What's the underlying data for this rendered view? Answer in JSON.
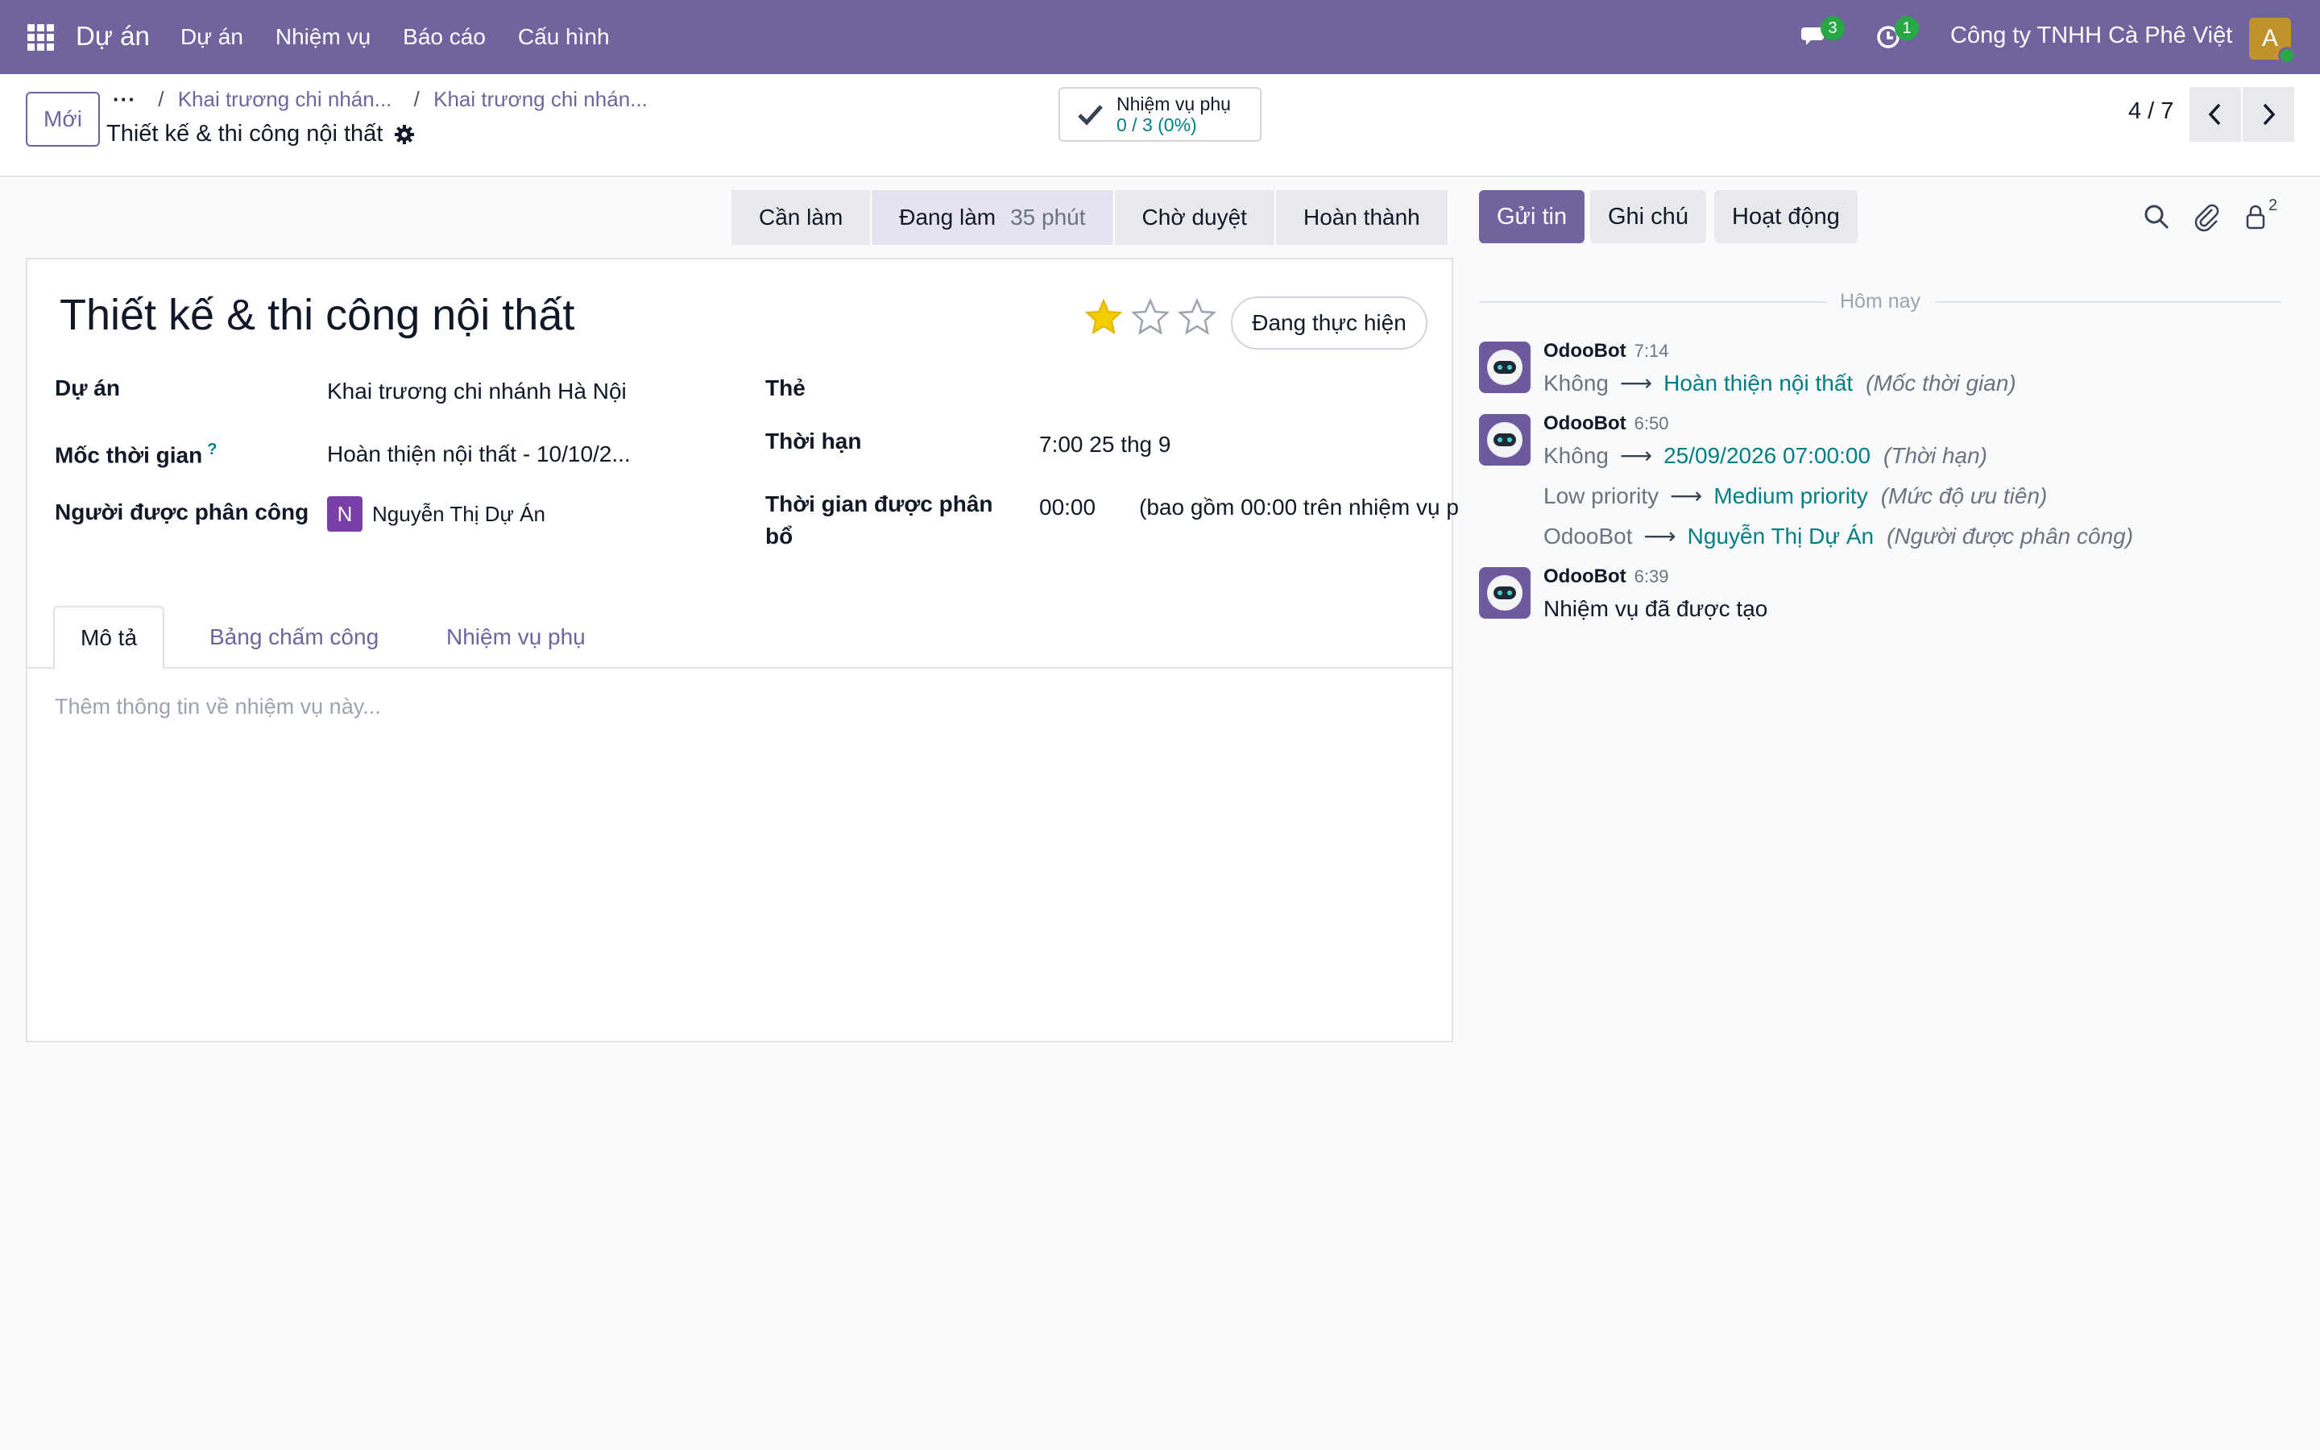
{
  "navbar": {
    "brand": "Dự án",
    "menu": [
      "Dự án",
      "Nhiệm vụ",
      "Báo cáo",
      "Cấu hình"
    ],
    "messages_count": "3",
    "activities_count": "1",
    "company": "Công ty TNHH Cà Phê Việt",
    "user_initial": "A",
    "accent_color": "#71639e"
  },
  "control": {
    "new_label": "Mới",
    "breadcrumb_more": "···",
    "breadcrumbs": [
      "Khai trương chi nhán...",
      "Khai trương chi nhán..."
    ],
    "record_title": "Thiết kế & thi công nội thất",
    "subtasks_label": "Nhiệm vụ phụ",
    "subtasks_value": "0 / 3 (0%)",
    "pager": "4 / 7"
  },
  "status": {
    "stages": [
      {
        "label": "Cần làm",
        "duration": ""
      },
      {
        "label": "Đang làm",
        "duration": "35 phút",
        "active": true
      },
      {
        "label": "Chờ duyệt",
        "duration": ""
      },
      {
        "label": "Hoàn thành",
        "duration": ""
      }
    ]
  },
  "form": {
    "task_name": "Thiết kế & thi công nội thất",
    "priority_stars": 1,
    "priority_max": 3,
    "state_label": "Đang thực hiện",
    "fields": {
      "project_label": "Dự án",
      "project_value": "Khai trương chi nhánh Hà Nội",
      "milestone_label": "Mốc thời gian",
      "milestone_help": "?",
      "milestone_value": "Hoàn thiện nội thất - 10/10/2...",
      "assignee_label": "Người được phân công",
      "assignee_initial": "N",
      "assignee_value": "Nguyễn Thị Dự Án",
      "tags_label": "Thẻ",
      "deadline_label": "Thời hạn",
      "deadline_value": "7:00 25 thg 9",
      "allocated_label_1": "Thời gian được phân",
      "allocated_label_2": "bổ",
      "allocated_value": "00:00",
      "allocated_note": "(bao gồm 00:00 trên nhiệm vụ p"
    },
    "tabs": [
      "Mô tả",
      "Bảng chấm công",
      "Nhiệm vụ phụ"
    ],
    "description_placeholder": "Thêm thông tin về nhiệm vụ này..."
  },
  "chatter": {
    "send_label": "Gửi tin",
    "note_label": "Ghi chú",
    "activity_label": "Hoạt động",
    "followers_count": "2",
    "today": "Hôm nay",
    "messages": [
      {
        "author": "OdooBot",
        "time": "7:14",
        "tracking": [
          {
            "old": "Không",
            "new": "Hoàn thiện nội thất",
            "field": "(Mốc thời gian)"
          }
        ]
      },
      {
        "author": "OdooBot",
        "time": "6:50",
        "tracking": [
          {
            "old": "Không",
            "new": "25/09/2026 07:00:00",
            "field": "(Thời hạn)"
          },
          {
            "old": "Low priority",
            "new": "Medium priority",
            "field": "(Mức độ ưu tiên)"
          },
          {
            "old": "OdooBot",
            "new": "Nguyễn Thị Dự Án",
            "field": "(Người được phân công)"
          }
        ]
      },
      {
        "author": "OdooBot",
        "time": "6:39",
        "body": "Nhiệm vụ đã được tạo"
      }
    ]
  }
}
